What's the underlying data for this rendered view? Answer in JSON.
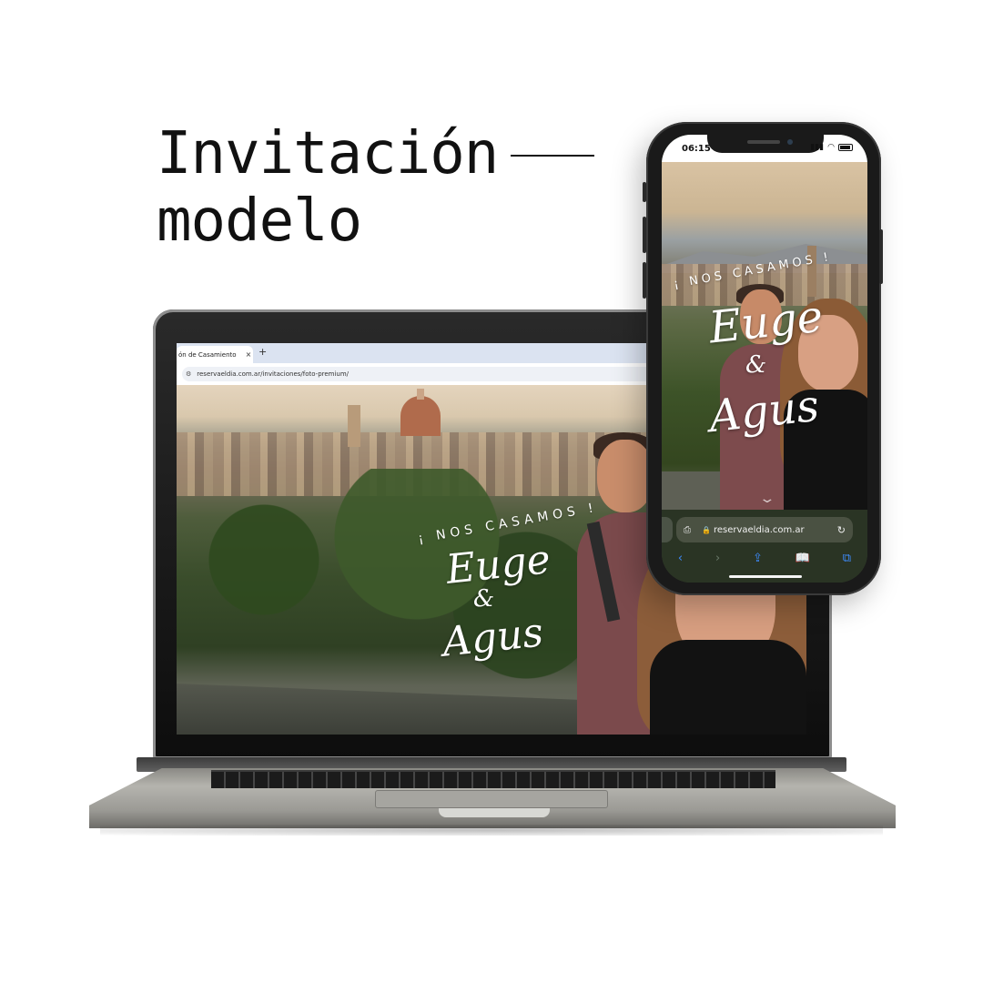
{
  "heading": {
    "line1": "Invitación",
    "line2": "modelo"
  },
  "laptop": {
    "browser": {
      "tab_title": "ón de Casamiento",
      "tab_close": "×",
      "new_tab": "+",
      "site_icon": "tune-icon",
      "url": "reservaeldia.com.ar/invitaciones/foto-premium/"
    },
    "invitation": {
      "tagline": "¡ NOS CASAMOS !",
      "name1": "Euge",
      "ampersand": "&",
      "name2": "Agus"
    }
  },
  "phone": {
    "status": {
      "time": "06:15",
      "signal": "▮▮▮",
      "wifi": "◠"
    },
    "invitation": {
      "tagline": "¡ NOS CASAMOS !",
      "name1": "Euge",
      "ampersand": "&",
      "name2": "Agus",
      "scroll_hint": "⌄"
    },
    "safari": {
      "page_icon": "⎙",
      "lock": "🔒",
      "url": "reservaeldia.com.ar",
      "reload": "↻",
      "back": "‹",
      "forward": "›",
      "share": "⇪",
      "bookmarks": "📖",
      "tabs": "⧉"
    }
  },
  "colors": {
    "text_dark": "#111111",
    "safari_accent": "#3d8bfd",
    "invitation_text": "#ffffff"
  }
}
